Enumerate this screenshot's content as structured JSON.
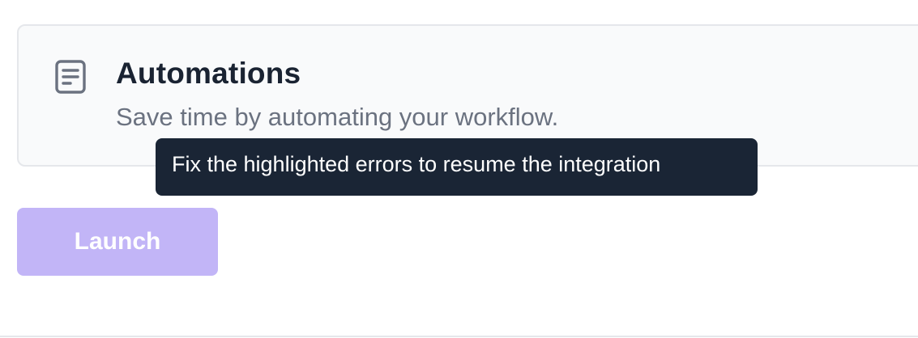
{
  "card": {
    "icon": "document-icon",
    "title": "Automations",
    "description": "Save time by automating your workflow."
  },
  "tooltip": {
    "text": "Fix the highlighted errors to resume the integration"
  },
  "launch_button": {
    "label": "Launch",
    "state": "disabled",
    "color": "#c2b5f7"
  },
  "colors": {
    "tooltip_background": "#1a2535",
    "title": "#1a2332",
    "description": "#6b7280",
    "card_border": "#e5e7eb",
    "card_background": "#f9fafb"
  }
}
